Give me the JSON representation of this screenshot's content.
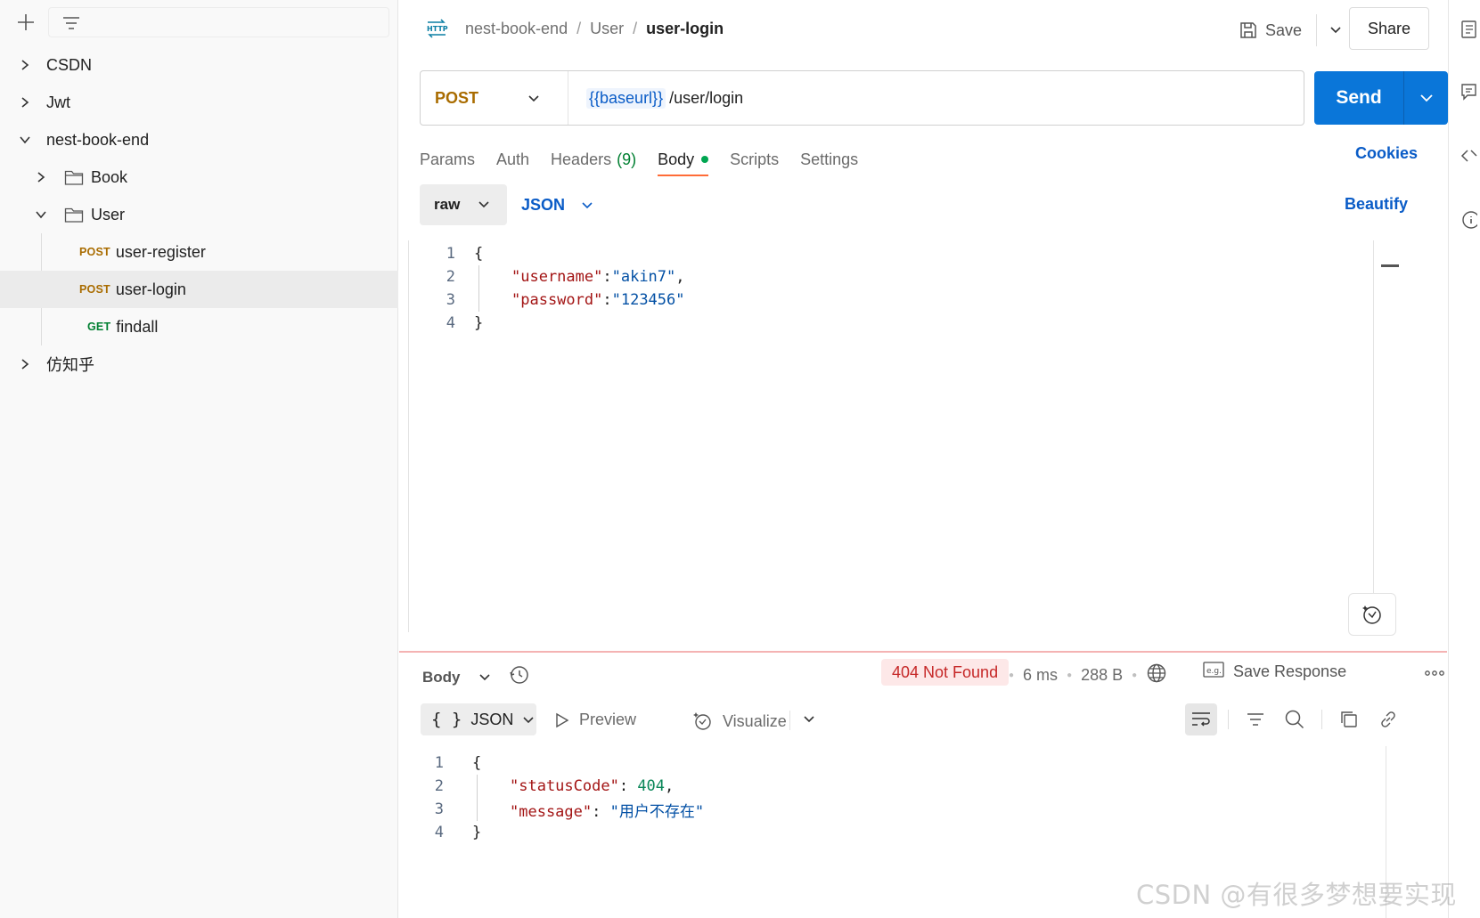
{
  "sidebar": {
    "tree": [
      {
        "label": "CSDN"
      },
      {
        "label": "Jwt"
      },
      {
        "label": "nest-book-end"
      },
      {
        "label": "Book"
      },
      {
        "label": "User"
      },
      {
        "method": "POST",
        "label": "user-register"
      },
      {
        "method": "POST",
        "label": "user-login"
      },
      {
        "method": "GET",
        "label": "findall"
      },
      {
        "label": "仿知乎"
      }
    ]
  },
  "header": {
    "breadcrumb": [
      "nest-book-end",
      "User",
      "user-login"
    ],
    "separator": "/",
    "save_label": "Save",
    "share_label": "Share"
  },
  "request": {
    "method": "POST",
    "url_variable": "{{baseurl}}",
    "url_path": "/user/login",
    "send_label": "Send"
  },
  "tabs": {
    "params": "Params",
    "auth": "Auth",
    "headers": "Headers",
    "headers_count": "(9)",
    "body": "Body",
    "scripts": "Scripts",
    "settings": "Settings",
    "cookies": "Cookies"
  },
  "body_toolbar": {
    "mode": "raw",
    "language": "JSON",
    "beautify": "Beautify"
  },
  "request_body": {
    "line_numbers": [
      "1",
      "2",
      "3",
      "4"
    ],
    "open_brace": "{",
    "close_brace": "}",
    "key1": "\"username\"",
    "value1": "\"akin7\"",
    "key2": "\"password\"",
    "value2": "\"123456\""
  },
  "response": {
    "body_label": "Body",
    "status": "404 Not Found",
    "time": "6 ms",
    "size": "288 B",
    "save_response": "Save Response",
    "format": "JSON",
    "preview": "Preview",
    "visualize": "Visualize",
    "line_numbers": [
      "1",
      "2",
      "3",
      "4"
    ],
    "open_brace": "{",
    "close_brace": "}",
    "key1": "\"statusCode\"",
    "value1": "404",
    "key2": "\"message\"",
    "value2": "\"用户不存在\""
  },
  "watermark": "CSDN @有很多梦想要实现",
  "colors": {
    "send_button": "#0a76d9",
    "post_method": "#a96c00",
    "get_method": "#007f31",
    "status_error": "#c62828",
    "tab_indicator": "#ff6c37",
    "link_blue": "#0a5cc7"
  }
}
